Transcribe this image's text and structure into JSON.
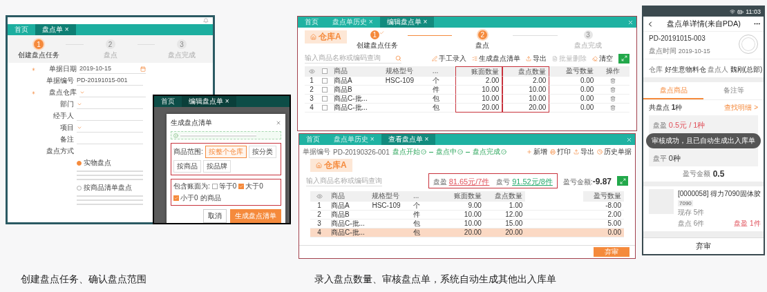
{
  "left_shot": {
    "tabs": [
      {
        "label": "首页",
        "selected": false
      },
      {
        "label": "盘点单 ×",
        "selected": true
      }
    ],
    "steps": [
      {
        "number": "1",
        "label": "创建盘点任务",
        "selected": true,
        "completed": false
      },
      {
        "number": "2",
        "label": "盘点",
        "selected": false,
        "completed": false
      },
      {
        "number": "3",
        "label": "盘点完成",
        "selected": false,
        "completed": false
      }
    ],
    "fields": [
      {
        "label": "单据日期",
        "value": "2019-10-15",
        "required": true,
        "kind": "date"
      },
      {
        "label": "单据编号",
        "value": "PD-20191015-001",
        "required": false,
        "kind": "text"
      },
      {
        "label": "盘点仓库",
        "required": true,
        "kind": "select"
      },
      {
        "label": "部门",
        "required": false,
        "kind": "select"
      },
      {
        "label": "经手人",
        "required": false,
        "kind": "text"
      },
      {
        "label": "项目",
        "required": false,
        "kind": "select"
      },
      {
        "label": "备注",
        "required": false,
        "kind": "text"
      }
    ],
    "method_label": "盘点方式",
    "methods": [
      {
        "label": "实物盘点",
        "selected": true
      },
      {
        "label": "按商品清单盘点",
        "selected": false
      }
    ]
  },
  "dialog": {
    "tabs": [
      {
        "label": "首页",
        "selected": false
      },
      {
        "label": "编辑盘点单 ×",
        "selected": true
      }
    ],
    "title": "生成盘点清单",
    "range_label": "商品范围:",
    "range_options": [
      {
        "label": "按整个仓库",
        "selected": true
      },
      {
        "label": "按分类",
        "selected": false
      },
      {
        "label": "按商品",
        "selected": false
      },
      {
        "label": "按品牌",
        "selected": false
      }
    ],
    "include_label": "包含账面为:",
    "include_options": [
      {
        "label": "等于0",
        "checked": false
      },
      {
        "label": "大于0",
        "checked": true
      },
      {
        "label": "小于0",
        "checked": true
      }
    ],
    "include_suffix": "的商品",
    "buttons": [
      {
        "label": "取消",
        "kind": "default"
      },
      {
        "label": "生成盘点清单",
        "kind": "primary"
      }
    ]
  },
  "edit_window": {
    "tabs": [
      {
        "label": "首页",
        "selected": false
      },
      {
        "label": "盘点单历史 ×",
        "selected": false
      },
      {
        "label": "编辑盘点单 ×",
        "selected": true
      }
    ],
    "warehouse": "仓库A",
    "steps": [
      {
        "number": "1",
        "label": "创建盘点任务",
        "selected": false,
        "completed": true
      },
      {
        "number": "2",
        "label": "盘点",
        "selected": true,
        "completed": false
      },
      {
        "number": "3",
        "label": "盘点完成",
        "selected": false,
        "completed": false
      }
    ],
    "select_all": false,
    "search": {
      "placeholder": "输入商品名称或编码查询"
    },
    "actions": [
      {
        "label": "手工录入",
        "disabled": false
      },
      {
        "label": "生成盘点清单",
        "disabled": false
      },
      {
        "label": "导出",
        "disabled": false
      },
      {
        "label": "批量删除",
        "disabled": true
      },
      {
        "label": "清空",
        "disabled": false
      }
    ],
    "columns": [
      {
        "label": "商品",
        "highlighted": false
      },
      {
        "label": "规格型号",
        "highlighted": false
      },
      {
        "label": "...",
        "highlighted": false
      },
      {
        "label": "账面数量",
        "highlighted": true
      },
      {
        "label": "盘点数量",
        "highlighted": true
      },
      {
        "label": "盈亏数量",
        "highlighted": false
      },
      {
        "label": "操作",
        "highlighted": false
      }
    ],
    "rows": [
      {
        "index": "1",
        "checked": false,
        "name": "商品A",
        "spec": "HSC-109",
        "unit": "个",
        "book": "2.00",
        "count": "2.00",
        "diff": "0.00"
      },
      {
        "index": "2",
        "checked": false,
        "name": "商品B",
        "unit": "件",
        "book": "10.00",
        "count": "10.00",
        "diff": "0.00"
      },
      {
        "index": "3",
        "checked": false,
        "name": "商品C-批...",
        "unit": "包",
        "book": "10.00",
        "count": "10.00",
        "diff": "0.00"
      },
      {
        "index": "4",
        "checked": false,
        "name": "商品C-批...",
        "unit": "包",
        "book": "20.00",
        "count": "20.00",
        "diff": "0.00"
      }
    ]
  },
  "view_window": {
    "tabs": [
      {
        "label": "首页",
        "selected": false
      },
      {
        "label": "盘点单历史 ×",
        "selected": false
      },
      {
        "label": "查看盘点单 ×",
        "selected": true
      }
    ],
    "doc_label": "单据编号",
    "doc_no": "PD-20190326-001",
    "progress": [
      {
        "label": "盘点开始",
        "done": true
      },
      {
        "label": "盘点中",
        "done": true
      },
      {
        "label": "盘点完成",
        "done": true
      }
    ],
    "actions": [
      {
        "label": "新增",
        "kind": "add"
      },
      {
        "label": "打印",
        "kind": "print"
      },
      {
        "label": "导出",
        "kind": "export"
      },
      {
        "label": "历史单据",
        "kind": "history"
      }
    ],
    "warehouse": "仓库A",
    "search": {
      "placeholder": "输入商品名称或编码查询"
    },
    "gain_label": "盘盈",
    "gain_value": "81.65元/7件",
    "loss_label": "盘亏",
    "loss_value": "91.52元/8件",
    "diff_label": "盈亏金额:",
    "diff_value": "-9.87",
    "columns": [
      "商品",
      "规格型号",
      "...",
      "账面数量",
      "盘点数量",
      "盈亏数量"
    ],
    "rows": [
      {
        "index": "1",
        "selected": false,
        "name": "商品A",
        "spec": "HSC-109",
        "unit": "个",
        "book": "9.00",
        "count": "1.00",
        "diff": "-8.00"
      },
      {
        "index": "2",
        "selected": false,
        "name": "商品B",
        "unit": "件",
        "book": "10.00",
        "count": "12.00",
        "diff": "2.00"
      },
      {
        "index": "3",
        "selected": false,
        "name": "商品C-批...",
        "unit": "包",
        "book": "10.00",
        "count": "15.00",
        "diff": "5.00"
      },
      {
        "index": "4",
        "selected": true,
        "name": "商品C-批...",
        "unit": "包",
        "book": "20.00",
        "count": "20.00",
        "diff": "0.00"
      }
    ],
    "footer_button": "弃审"
  },
  "phone": {
    "time": "11:03",
    "title": "盘点单详情(来自PDA)",
    "doc_no": "PD-20191015-003",
    "time_label": "盘点时间",
    "date": "2019-10-15",
    "warehouse_label": "仓库",
    "warehouse": "好生意物料仓",
    "counter_label": "盘点人",
    "counter": "魏刚(总部)",
    "tabs": [
      {
        "label": "盘点商品",
        "selected": true
      },
      {
        "label": "备注等",
        "selected": false
      }
    ],
    "total": "共盘点 **1**种",
    "detail_link": "查找明细 >",
    "gain_label": "盘盈",
    "gain_value": "0.5元 / 1种",
    "toast": "审核成功，且已自动生成出入库单",
    "even_label": "盘平",
    "even_value": "0种",
    "amount_label": "盈亏金额",
    "amount_value": "0.5",
    "item": {
      "name": "[0000058] 得力7090固体胶",
      "tag": "7090",
      "stock": "现存 5件",
      "count": "盘点 6件",
      "status": "盘盈 1件"
    },
    "footer_button": "弃审"
  },
  "captions": [
    "创建盘点任务、确认盘点范围",
    "录入盘点数量、审核盘点单，系统自动生成其他出入库单"
  ]
}
